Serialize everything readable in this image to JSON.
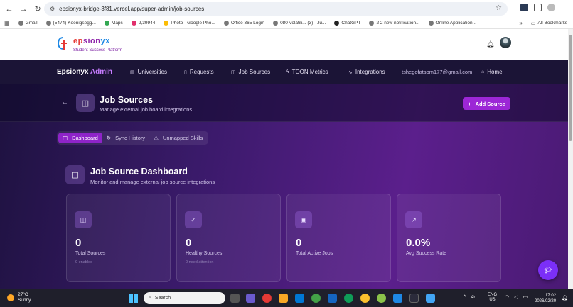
{
  "browser": {
    "url": "epsionyx-bridge-3f81.vercel.app/super-admin/job-sources",
    "bookmarks": [
      {
        "label": "Gmail"
      },
      {
        "label": "(5474) Koenigsegg..."
      },
      {
        "label": "Maps"
      },
      {
        "label": "2,39944"
      },
      {
        "label": "Photo - Google Pho..."
      },
      {
        "label": "Office 365 Login"
      },
      {
        "label": "080-volatili... (3) - Ju..."
      },
      {
        "label": "ChatGPT"
      },
      {
        "label": "2 2 new notification..."
      },
      {
        "label": "Online Application..."
      }
    ],
    "all_bookmarks": "All Bookmarks"
  },
  "app": {
    "logo_name_part1": "ep",
    "logo_name_part2": "sion",
    "logo_name_part3": "yx",
    "logo_tagline": "Student Success Platform"
  },
  "admin_nav": {
    "brand_main": "Epsionyx",
    "brand_accent": "Admin",
    "items": [
      {
        "label": "Universities",
        "icon": "building-icon"
      },
      {
        "label": "Requests",
        "icon": "document-icon"
      },
      {
        "label": "Job Sources",
        "icon": "database-icon"
      },
      {
        "label": "TOON Metrics",
        "icon": "bolt-icon"
      },
      {
        "label": "Integrations",
        "icon": "activity-icon"
      }
    ],
    "email": "tshegofatsom177@gmail.com",
    "home": "Home"
  },
  "page_header": {
    "title": "Job Sources",
    "subtitle": "Manage external job board integrations",
    "add_button": "Add Source"
  },
  "tabs": [
    {
      "label": "Dashboard",
      "active": true
    },
    {
      "label": "Sync History",
      "active": false
    },
    {
      "label": "Unmapped Skills",
      "active": false
    }
  ],
  "dashboard": {
    "title": "Job Source Dashboard",
    "subtitle": "Monitor and manage external job source integrations",
    "cards": [
      {
        "value": "0",
        "label": "Total Sources",
        "note": "0 enabled",
        "icon": "database-icon"
      },
      {
        "value": "0",
        "label": "Healthy Sources",
        "note": "0 need attention",
        "icon": "check-circle-icon"
      },
      {
        "value": "0",
        "label": "Total Active Jobs",
        "note": "",
        "icon": "briefcase-icon"
      },
      {
        "value": "0.0%",
        "label": "Avg Success Rate",
        "note": "",
        "icon": "trending-up-icon"
      }
    ]
  },
  "taskbar": {
    "temp": "27°C",
    "weather": "Sunny",
    "search_placeholder": "Search",
    "lang1": "ENG",
    "lang2": "US",
    "time": "17:02",
    "date": "2026/02/20"
  },
  "colors": {
    "accent": "#9c27d6",
    "nav_bg": "#1b1436"
  }
}
